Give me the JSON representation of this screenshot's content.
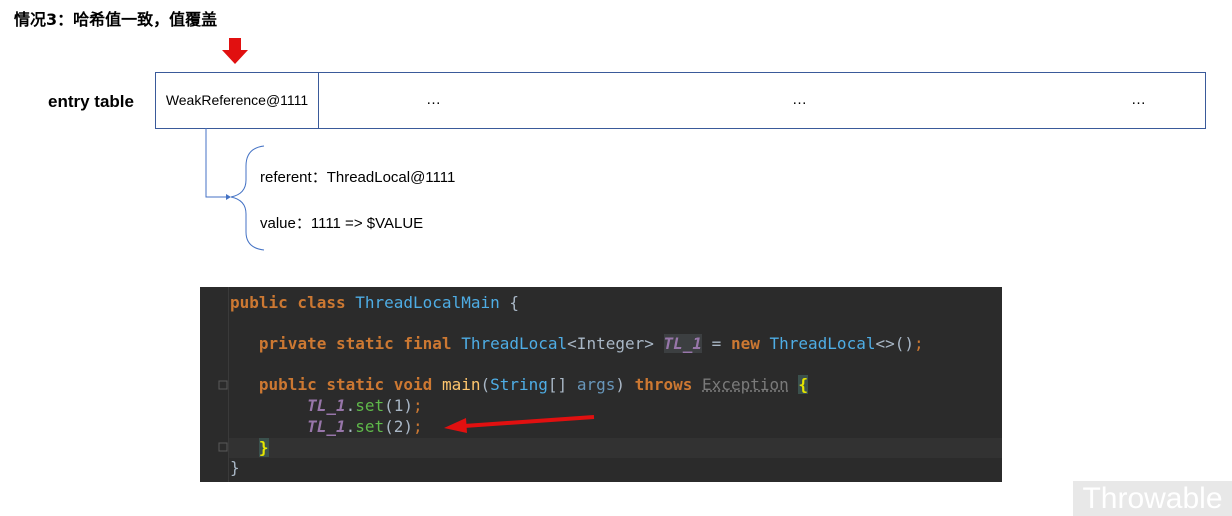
{
  "heading": "情况3：哈希值一致，值覆盖",
  "entry_table": {
    "label": "entry table",
    "cells": [
      "WeakReference@1111",
      "…",
      "…",
      "…"
    ]
  },
  "entry": {
    "referent": "referent：ThreadLocal@1111",
    "value": "value：1111  => $VALUE"
  },
  "code": {
    "line1_kw": "public class",
    "line1_class": "ThreadLocalMain",
    "line1_end": " {",
    "line2_kw": "private static final",
    "line2_type": "ThreadLocal",
    "line2_generic": "<Integer>",
    "line2_const": "TL_1",
    "line2_eq": " = ",
    "line2_new": "new",
    "line2_ctor": "ThreadLocal",
    "line2_end": "<>()",
    "line3_kw": "public static void",
    "line3_method": "main",
    "line3_paren": "(",
    "line3_argtype": "String",
    "line3_arr": "[] ",
    "line3_arg": "args",
    "line3_close": ") ",
    "line3_throws": "throws",
    "line3_ex": "Exception",
    "line4_const": "TL_1",
    "line4_call": "set",
    "line4_args": "(1)",
    "line5_const": "TL_1",
    "line5_call": "set",
    "line5_args": "(2)",
    "line6": "}",
    "line7": "}"
  },
  "watermark": "Throwable",
  "colors": {
    "arrow_red": "#e11010",
    "table_border": "#3a5a9a",
    "connector": "#4472c4",
    "code_bg": "#2b2b2b"
  }
}
